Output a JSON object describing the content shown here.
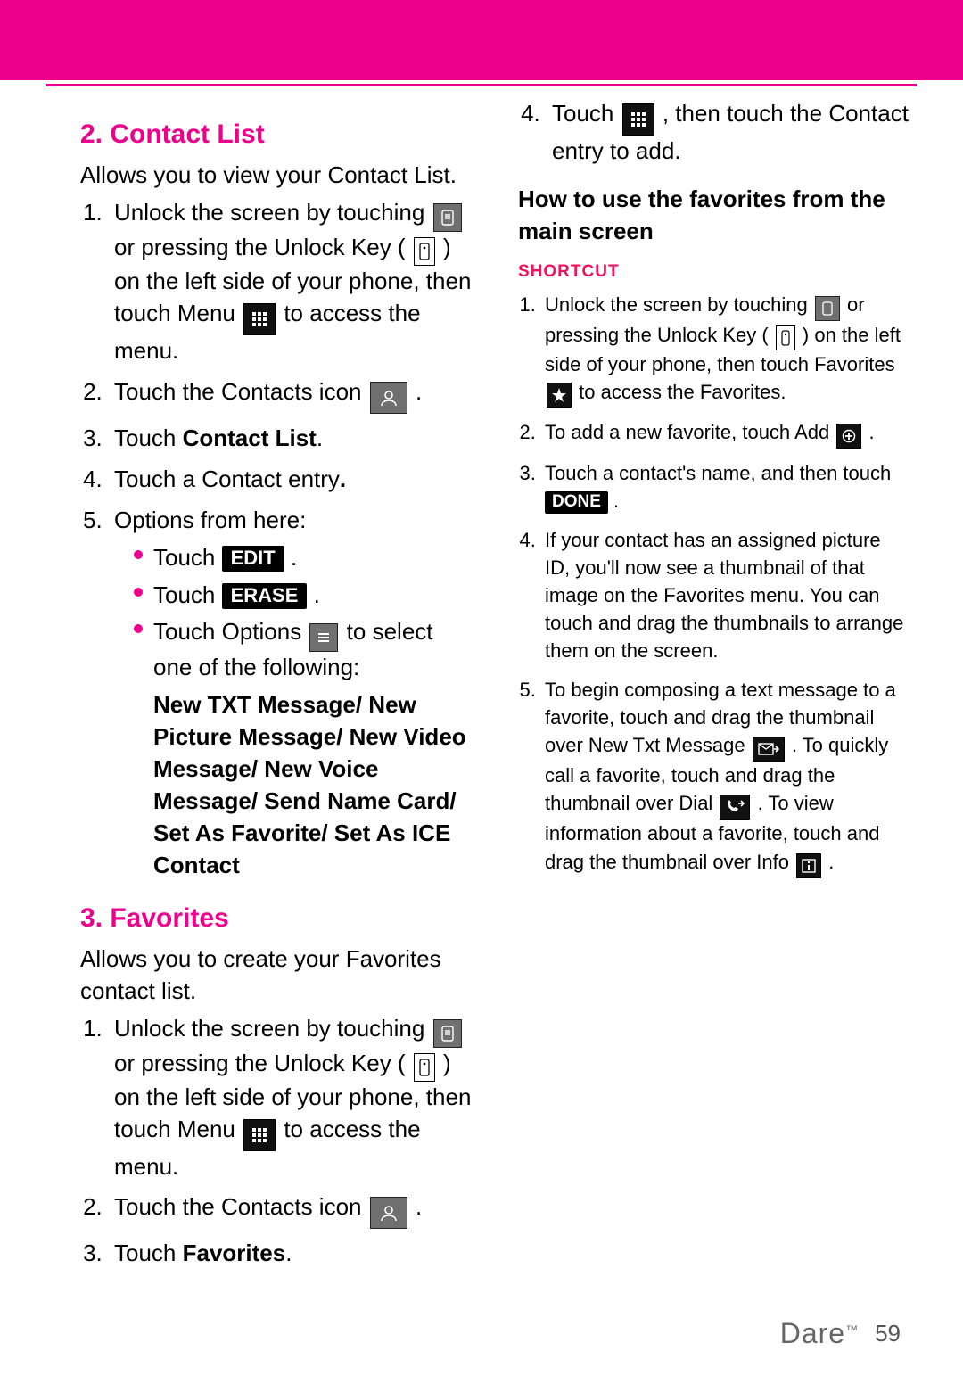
{
  "sections": {
    "contact_list": {
      "heading": "2. Contact List",
      "intro": "Allows you to view your Contact List.",
      "step1": {
        "a": "Unlock the screen by touching ",
        "b": " or pressing the Unlock Key ( ",
        "c": " ) on the left side of your phone, then touch Menu ",
        "d": " to access the menu."
      },
      "step2": {
        "a": "Touch the Contacts icon ",
        "b": " ."
      },
      "step3": {
        "a": "Touch ",
        "bold": "Contact List",
        "b": "."
      },
      "step4": {
        "a": "Touch a Contact entry",
        "b": "."
      },
      "step5": "Options from here:",
      "opts": {
        "edit": {
          "a": "Touch ",
          "btn": "EDIT",
          "b": " ."
        },
        "erase": {
          "a": "Touch ",
          "btn": "ERASE",
          "b": " ."
        },
        "options": {
          "a": "Touch Options ",
          "b": " to select one of the following:"
        },
        "options_bold": "New TXT Message/ New Picture Message/ New Video Message/ New Voice Message/ Send Name Card/ Set As Favorite/ Set As ICE Contact"
      }
    },
    "favorites": {
      "heading": "3. Favorites",
      "intro": "Allows you to create your Favorites contact list.",
      "step1": {
        "a": "Unlock the screen by touching ",
        "b": " or pressing the Unlock Key ( ",
        "c": " ) on the left side of your phone, then touch Menu ",
        "d": " to access the menu."
      },
      "step2": {
        "a": "Touch the Contacts icon ",
        "b": " ."
      },
      "step3": {
        "a": "Touch ",
        "bold": "Favorites",
        "b": "."
      },
      "step4": {
        "a": "Touch ",
        "b": " , then touch the Contact entry to add."
      }
    },
    "howto_heading": "How to use the favorites from the main screen",
    "shortcut_label": "SHORTCUT",
    "shortcut": {
      "s1": {
        "a": "Unlock the screen by touching ",
        "b": " or pressing the Unlock Key ( ",
        "c": " ) on the left side of your phone, then touch Favorites ",
        "d": " to access the Favorites."
      },
      "s2": {
        "a": "To add a new favorite, touch Add ",
        "b": " ."
      },
      "s3": {
        "a": "Touch a contact's name, and then touch ",
        "btn": "DONE",
        "b": " ."
      },
      "s4": "If your contact has an assigned picture ID, you'll now see a thumbnail of that image on the Favorites menu. You can touch and drag the thumbnails to arrange them on the screen.",
      "s5": {
        "a": "To begin composing a text message to a favorite, touch and drag the thumbnail over New Txt Message ",
        "b": " . To quickly call a favorite, touch and drag the thumbnail over Dial ",
        "c": " . To view information about a favorite, touch and drag the thumbnail over Info ",
        "d": " ."
      }
    }
  },
  "footer": {
    "brand": "Dare",
    "tm": "™",
    "page": "59"
  }
}
